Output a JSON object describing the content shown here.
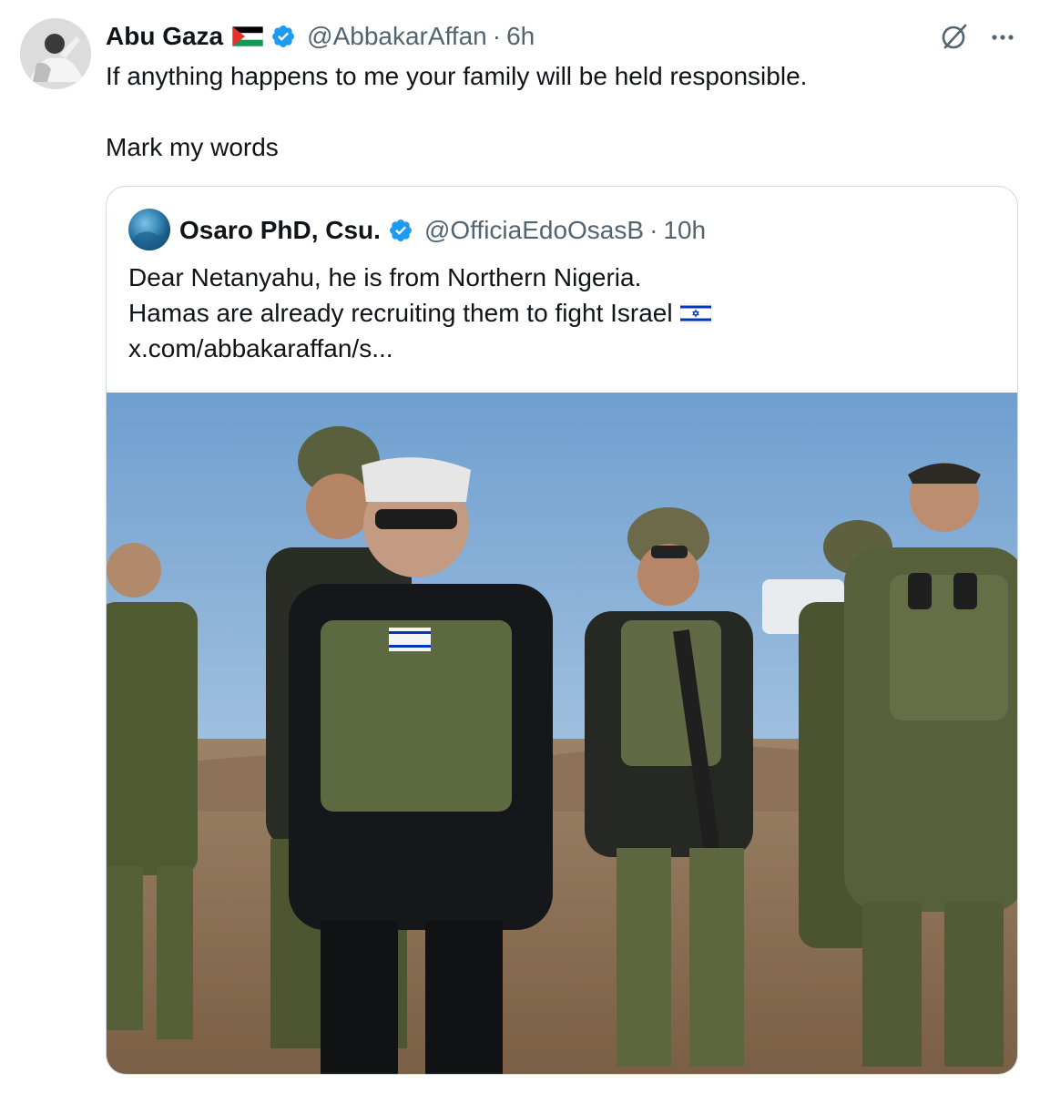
{
  "tweet": {
    "author_name": "Abu Gaza",
    "author_flag": "palestine-flag-icon",
    "author_handle": "@AbbakarAffan",
    "separator": "·",
    "time": "6h",
    "text_lines": [
      "If anything happens to me your family will be held responsible.",
      "Mark my words"
    ]
  },
  "quoted_tweet": {
    "author_name": "Osaro PhD, Csu.",
    "author_handle": "@OfficiaEdoOsasB",
    "separator": "·",
    "time": "10h",
    "text_lines": [
      "Dear Netanyahu, he is from Northern Nigeria.",
      "Hamas are already recruiting them to fight Israel",
      "x.com/abbakaraffan/s..."
    ],
    "inline_emoji": "israel-flag-icon"
  },
  "colors": {
    "text_primary": "#0f1419",
    "text_secondary": "#536471",
    "verified_blue": "#1d9bf0",
    "border": "#cfd9de"
  }
}
